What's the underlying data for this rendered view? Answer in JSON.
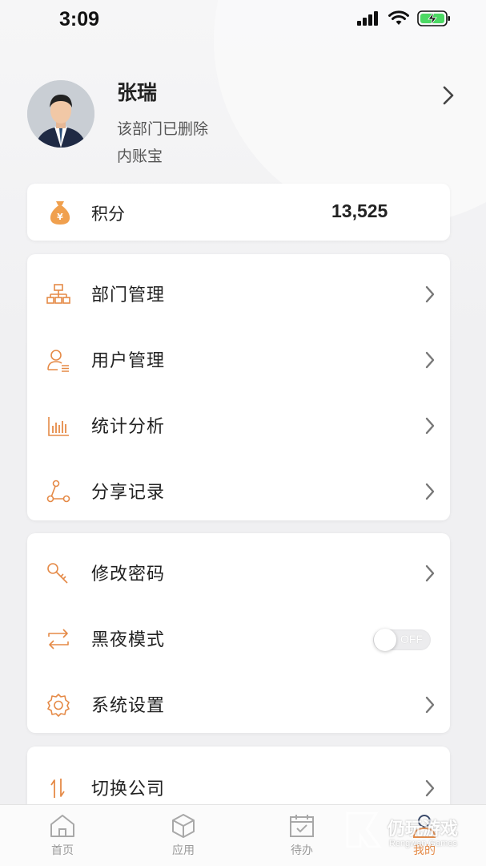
{
  "status_bar": {
    "time": "3:09"
  },
  "profile": {
    "name": "张瑞",
    "department": "该部门已删除",
    "company": "内账宝"
  },
  "points": {
    "label": "积分",
    "value": "13,525"
  },
  "management_menu": [
    {
      "label": "部门管理",
      "icon": "org-chart-icon"
    },
    {
      "label": "用户管理",
      "icon": "user-list-icon"
    },
    {
      "label": "统计分析",
      "icon": "bar-chart-icon"
    },
    {
      "label": "分享记录",
      "icon": "share-nodes-icon"
    }
  ],
  "settings_menu": [
    {
      "label": "修改密码",
      "icon": "key-icon"
    },
    {
      "label": "黑夜模式",
      "icon": "switch-arrows-icon",
      "toggle": "OFF"
    },
    {
      "label": "系统设置",
      "icon": "gear-icon"
    }
  ],
  "switch_menu": {
    "label": "切换公司",
    "icon": "swap-vertical-icon"
  },
  "tabs": [
    {
      "label": "首页",
      "icon": "home-icon"
    },
    {
      "label": "应用",
      "icon": "cube-icon"
    },
    {
      "label": "待办",
      "icon": "calendar-check-icon"
    },
    {
      "label": "我的",
      "icon": "user-icon",
      "active": true
    }
  ],
  "watermark": {
    "text": "仍玩游戏",
    "sub": "Rengwan Games"
  },
  "colors": {
    "accent": "#e58a47",
    "text": "#222222",
    "muted": "#9a9a9a"
  }
}
